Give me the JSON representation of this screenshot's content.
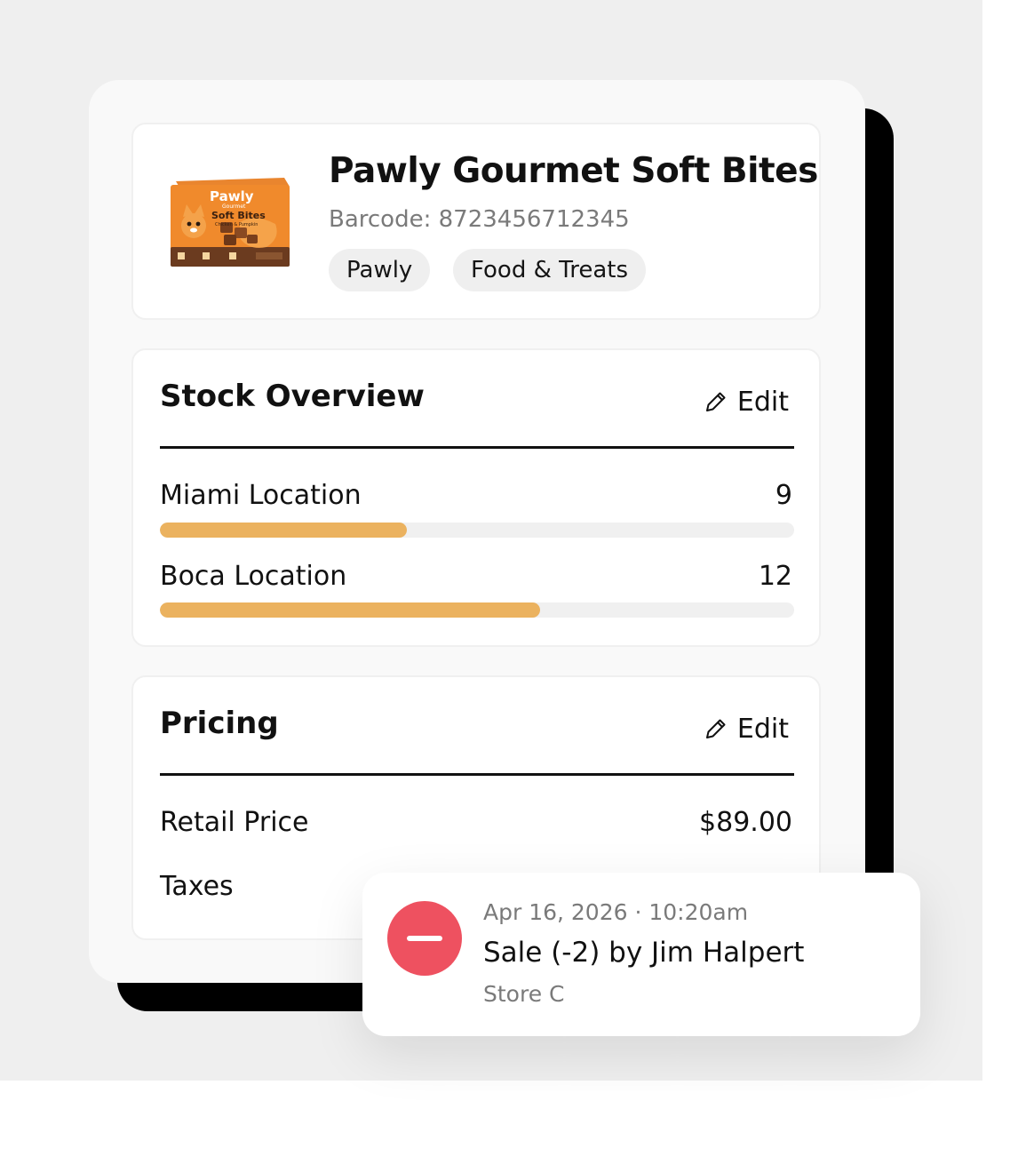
{
  "product": {
    "name": "Pawly Gourmet Soft Bites",
    "barcode": "Barcode: 8723456712345",
    "tags": [
      "Pawly",
      "Food & Treats"
    ],
    "image": {
      "brand": "Pawly",
      "sub": "Gourmet",
      "line": "Soft Bites",
      "flavor": "Chicken & Pumpkin"
    }
  },
  "stock": {
    "title": "Stock Overview",
    "edit_label": "Edit",
    "locations": [
      {
        "name": "Miami Location",
        "quantity": "9",
        "level": 0.39
      },
      {
        "name": "Boca Location",
        "quantity": "12",
        "level": 0.6
      }
    ]
  },
  "pricing": {
    "title": "Pricing",
    "edit_label": "Edit",
    "rows": [
      {
        "label": "Retail Price",
        "value": "$89.00"
      },
      {
        "label": "Taxes",
        "value": ""
      }
    ]
  },
  "notification": {
    "timestamp": "Apr 16, 2026 · 10:20am",
    "title": "Sale (-2) by Jim Halpert",
    "store": "Store C",
    "icon": "minus-circle-icon",
    "icon_color": "#ee5160"
  },
  "colors": {
    "bar_fill": "#ebb25f",
    "bar_track": "#f0f0f0",
    "card_shadow": "#000000"
  }
}
